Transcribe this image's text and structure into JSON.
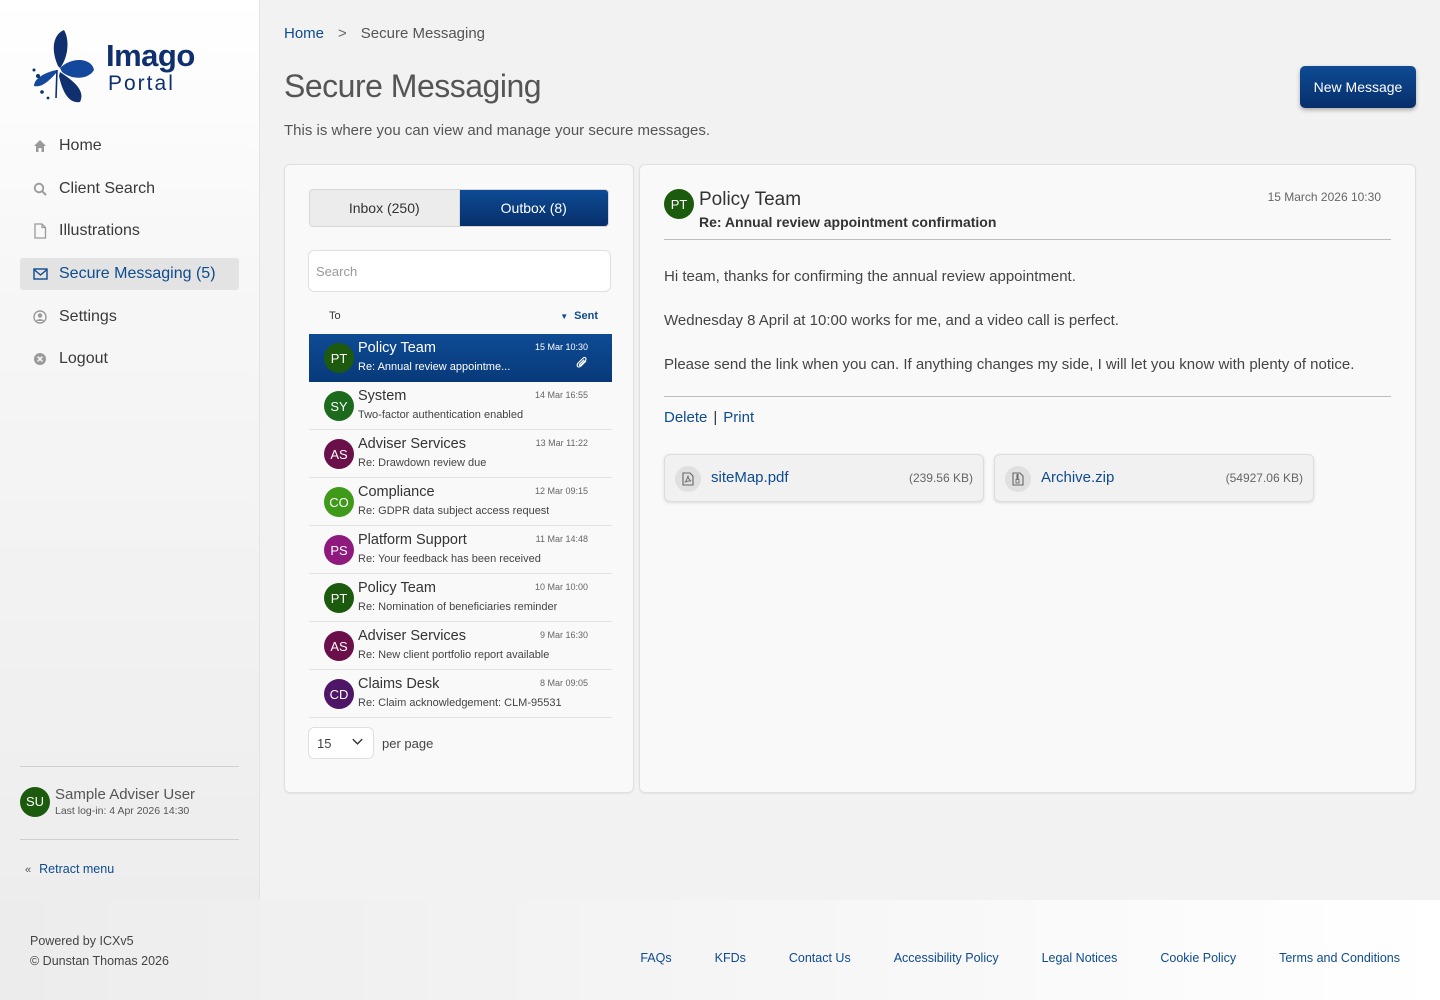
{
  "brand": {
    "name_line1": "Imago",
    "name_line2": "Portal",
    "color": "#0f2f6e"
  },
  "sidebar": {
    "items": [
      {
        "label": "Home",
        "icon": "home-icon"
      },
      {
        "label": "Client Search",
        "icon": "search-icon"
      },
      {
        "label": "Illustrations",
        "icon": "document-icon"
      },
      {
        "label": "Secure Messaging (5)",
        "icon": "envelope-icon",
        "active": true
      },
      {
        "label": "Settings",
        "icon": "user-circle-icon"
      },
      {
        "label": "Logout",
        "icon": "close-circle-icon"
      }
    ],
    "user": {
      "initials": "SU",
      "name": "Sample Adviser User",
      "last_login": "Last log-in: 4 Apr 2026 14:30"
    },
    "retract_label": "Retract menu"
  },
  "breadcrumb": {
    "home": "Home",
    "separator": ">",
    "current": "Secure Messaging"
  },
  "page": {
    "title": "Secure Messaging",
    "description": "This is where you can view and manage your secure messages.",
    "new_message_label": "New Message"
  },
  "mailbox": {
    "inbox_label": "Inbox (250)",
    "outbox_label": "Outbox (8)",
    "active_tab": "Outbox",
    "search_placeholder": "Search",
    "col_to": "To",
    "col_sent": "Sent",
    "messages": [
      {
        "initials": "PT",
        "name": "Policy Team",
        "subject": "Re: Annual review appointme...",
        "time": "15 Mar 10:30",
        "color": "#1c5a0e",
        "selected": true,
        "attachment": true
      },
      {
        "initials": "SY",
        "name": "System",
        "subject": "Two-factor authentication enabled",
        "time": "14 Mar 16:55",
        "color": "#1c6b1c"
      },
      {
        "initials": "AS",
        "name": "Adviser Services",
        "subject": "Re: Drawdown review due",
        "time": "13 Mar 11:22",
        "color": "#6b0f4a"
      },
      {
        "initials": "CO",
        "name": "Compliance",
        "subject": "Re: GDPR data subject access request",
        "time": "12 Mar 09:15",
        "color": "#3f9a1a"
      },
      {
        "initials": "PS",
        "name": "Platform Support",
        "subject": "Re: Your feedback has been received",
        "time": "11 Mar 14:48",
        "color": "#8e1a7e"
      },
      {
        "initials": "PT",
        "name": "Policy Team",
        "subject": "Re: Nomination of beneficiaries reminder",
        "time": "10 Mar 10:00",
        "color": "#1c5a0e"
      },
      {
        "initials": "AS",
        "name": "Adviser Services",
        "subject": "Re: New client portfolio report available",
        "time": "9 Mar 16:30",
        "color": "#6b0f4a"
      },
      {
        "initials": "CD",
        "name": "Claims Desk",
        "subject": "Re: Claim acknowledgement: CLM-95531",
        "time": "8 Mar 09:05",
        "color": "#4f1566"
      }
    ],
    "per_page_value": "15",
    "per_page_label": "per page"
  },
  "message": {
    "initials": "PT",
    "from": "Policy Team",
    "subject": "Re: Annual review appointment confirmation",
    "date": "15 March 2026 10:30",
    "body": [
      "Hi team, thanks for confirming the annual review appointment.",
      "Wednesday 8 April at 10:00 works for me, and a video call is perfect.",
      "Please send the link when you can. If anything changes my side, I will let you know with plenty of notice."
    ],
    "delete_label": "Delete",
    "print_label": "Print",
    "separator": "|",
    "attachments": [
      {
        "name": "siteMap.pdf",
        "size": "(239.56 KB)",
        "icon": "pdf-file-icon"
      },
      {
        "name": "Archive.zip",
        "size": "(54927.06 KB)",
        "icon": "zip-file-icon"
      }
    ]
  },
  "footer": {
    "powered": "Powered by ICXv5",
    "copyright": "© Dunstan Thomas 2026",
    "links": [
      "FAQs",
      "KFDs",
      "Contact Us",
      "Accessibility Policy",
      "Legal Notices",
      "Cookie Policy",
      "Terms and Conditions"
    ]
  },
  "colors": {
    "accent": "#0e4b94",
    "link": "#0e4b8f"
  }
}
